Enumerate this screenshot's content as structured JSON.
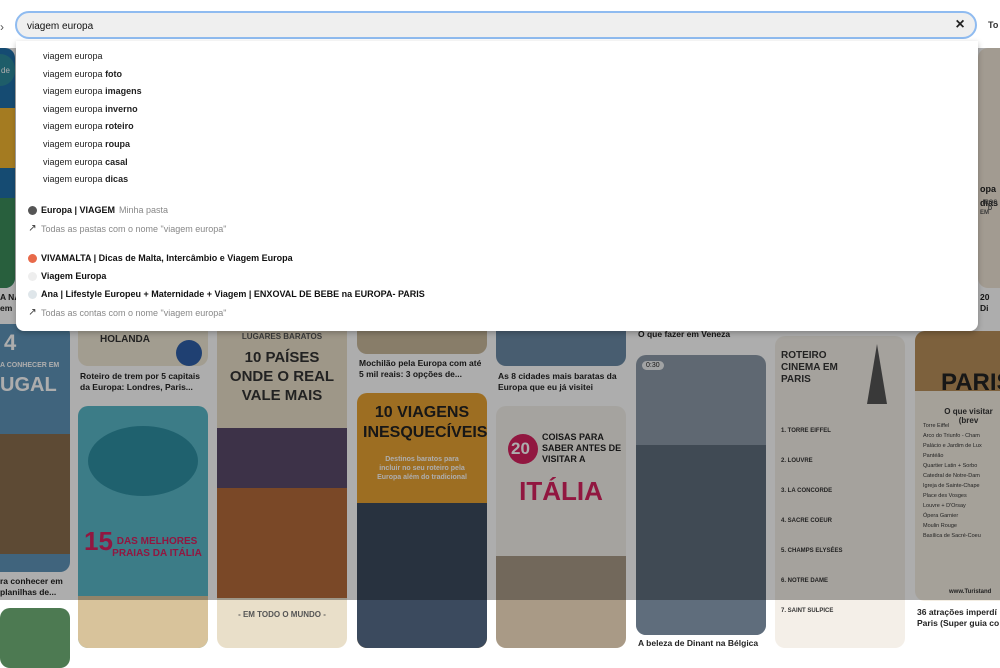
{
  "search": {
    "value": "viagem europa",
    "clear_icon": "×"
  },
  "right_edge_text": "To",
  "left_edge_text": "de",
  "suggestions": [
    {
      "base": "viagem europa",
      "extra": ""
    },
    {
      "base": "viagem europa",
      "extra": "foto"
    },
    {
      "base": "viagem europa",
      "extra": "imagens"
    },
    {
      "base": "viagem europa",
      "extra": "inverno"
    },
    {
      "base": "viagem europa",
      "extra": "roteiro"
    },
    {
      "base": "viagem europa",
      "extra": "roupa"
    },
    {
      "base": "viagem europa",
      "extra": "casal"
    },
    {
      "base": "viagem europa",
      "extra": "dicas"
    }
  ],
  "boards": {
    "board_name": "Europa | VIAGEM",
    "board_meta": "Minha pasta",
    "all_boards_link": "Todas as pastas com o nome \"viagem europa\""
  },
  "accounts": {
    "items": [
      {
        "name": "VIVAMALTA | Dicas de Malta, Intercâmbio e Viagem Europa",
        "color": "#e86a4a"
      },
      {
        "name": "Viagem Europa",
        "color": "#eeeeee"
      },
      {
        "name": "Ana | Lifestyle Europeu + Maternidade + Viagem | ENXOVAL DE BEBE na EUROPA- PARIS",
        "color": "#dfe6ea"
      }
    ],
    "all_accounts_link": "Todas as contas com o nome \"viagem europa\""
  },
  "pins": {
    "captions": {
      "c1_top": "A NA",
      "c1_top2": "em",
      "c1_bottom": "ra conhecer em",
      "c1_bottom2": "planilhas de...",
      "c2_top": "Roteiro de trem por 5 capitais",
      "c2_top2": "da Europa: Londres, Paris...",
      "c3_top": "Mochilão pela Europa com até",
      "c3_top2": "5 mil reais: 3 opções de...",
      "c4_top": "As 8 cidades mais baratas da",
      "c4_top2": "Europa que eu já visitei",
      "c5_top": "O que fazer em Veneza",
      "c5_bottom": "A beleza de Dinant na Bélgica",
      "c7_top": "36 atrações imperdí",
      "c7_top2": "Paris (Super guia co",
      "c7_right": "20 Di"
    },
    "posters": {
      "holanda": "HOLANDA",
      "lugares": "LUGARES BARATOS",
      "paises": "10 PAÍSES ONDE O REAL VALE MAIS",
      "todo_mundo": "- EM TODO O MUNDO -",
      "viagens": "10 VIAGENS INESQUECÍVEIS",
      "viagens_sub": "Destinos baratos para incluir no seu roteiro pela Europa além do tradicional",
      "praias_num": "15",
      "praias": "DAS MELHORES PRAIAS DA ITÁLIA",
      "coisas_num": "20",
      "coisas": "COISAS PARA SABER ANTES DE VISITAR A",
      "italia": "ITÁLIA",
      "video_time": "0:30",
      "cinema": "ROTEIRO CINEMA EM PARIS",
      "cinema_items": [
        "1. TORRE EIFFEL",
        "2. LOUVRE",
        "3. LA CONCORDE",
        "4. SACRE COEUR",
        "5. CHAMPS ELYSÉES",
        "6. NOTRE DAME",
        "7. SAINT SULPICE"
      ],
      "paris": "PARIS",
      "paris_sub": "O que visitar (brev",
      "paris_list": [
        "Torre Eiffel",
        "Arco do Triunfo - Cham",
        "Palácio e Jardim de Lux",
        "Pantéão",
        "Quartier Latin + Sorbo",
        "Catedral de Notre-Dam",
        "Igreja de Sainte-Chape",
        "Place des Vosges",
        "Louvre + D'Orsay",
        "Ópera Garnier",
        "Moulin Rouge",
        "Basílica de Sacré-Coeu"
      ],
      "paris_site": "www.Turistand",
      "gal_left": "4",
      "gal_left2": "A CONHECER EM",
      "gal_left3": "UGAL",
      "europa_right": "opa",
      "europa_right2": "dias",
      "europa_right3": "IROS D",
      "europa_right4": "EM"
    }
  },
  "colors": {
    "accent_border": "#8fbbf0",
    "search_bg": "#efefef",
    "poster_orange": "#e8a233",
    "poster_pink": "#d6225f"
  }
}
